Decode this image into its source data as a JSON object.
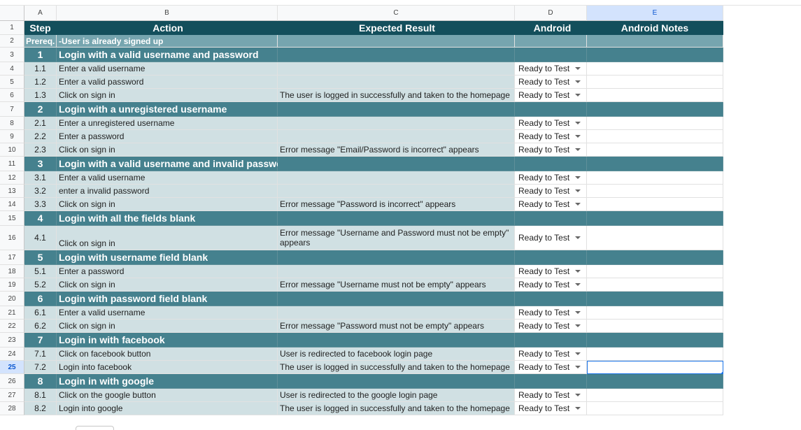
{
  "columns": [
    "A",
    "B",
    "C",
    "D",
    "E"
  ],
  "header_row": {
    "rownum": "1",
    "step": "Step",
    "action": "Action",
    "expected": "Expected Result",
    "android": "Android",
    "notes": "Android Notes"
  },
  "prereq": {
    "rownum": "2",
    "label": "Prereq.",
    "text": "-User is already signed up"
  },
  "groups": [
    {
      "rownum": "3",
      "num": "1",
      "title": "Login with a valid username and password",
      "steps": [
        {
          "rownum": "4",
          "num": "1.1",
          "action": "Enter a valid username",
          "expected": "",
          "status": "Ready to Test"
        },
        {
          "rownum": "5",
          "num": "1.2",
          "action": "Enter a valid password",
          "expected": "",
          "status": "Ready to Test"
        },
        {
          "rownum": "6",
          "num": "1.3",
          "action": "Click on sign in",
          "expected": "The user is logged in successfully and taken to the homepage",
          "status": "Ready to Test"
        }
      ]
    },
    {
      "rownum": "7",
      "num": "2",
      "title": "Login with a unregistered username",
      "steps": [
        {
          "rownum": "8",
          "num": "2.1",
          "action": "Enter a unregistered username",
          "expected": "",
          "status": "Ready to Test"
        },
        {
          "rownum": "9",
          "num": "2.2",
          "action": "Enter a password",
          "expected": "",
          "status": "Ready to Test"
        },
        {
          "rownum": "10",
          "num": "2.3",
          "action": "Click on sign in",
          "expected": "Error message \"Email/Password is incorrect\" appears",
          "status": "Ready to Test"
        }
      ]
    },
    {
      "rownum": "11",
      "num": "3",
      "title": "Login with a valid username and invalid password",
      "steps": [
        {
          "rownum": "12",
          "num": "3.1",
          "action": "Enter a valid username",
          "expected": "",
          "status": "Ready to Test"
        },
        {
          "rownum": "13",
          "num": "3.2",
          "action": "enter a invalid password",
          "expected": "",
          "status": "Ready to Test"
        },
        {
          "rownum": "14",
          "num": "3.3",
          "action": "Click on sign in",
          "expected": "Error message \"Password is incorrect\" appears",
          "status": "Ready to Test"
        }
      ]
    },
    {
      "rownum": "15",
      "num": "4",
      "title": "Login with all the fields blank",
      "steps": [
        {
          "rownum": "16",
          "num": "4.1",
          "action": "Click on sign in",
          "expected": "Error message \"Username and Password must not be empty\" appears",
          "status": "Ready to Test",
          "tall": true
        }
      ]
    },
    {
      "rownum": "17",
      "num": "5",
      "title": "Login with username field blank",
      "steps": [
        {
          "rownum": "18",
          "num": "5.1",
          "action": "Enter a password",
          "expected": "",
          "status": "Ready to Test"
        },
        {
          "rownum": "19",
          "num": "5.2",
          "action": "Click on sign in",
          "expected": "Error message \"Username must not be empty\" appears",
          "status": "Ready to Test"
        }
      ]
    },
    {
      "rownum": "20",
      "num": "6",
      "title": "Login with password field blank",
      "steps": [
        {
          "rownum": "21",
          "num": "6.1",
          "action": "Enter a valid username",
          "expected": "",
          "status": "Ready to Test"
        },
        {
          "rownum": "22",
          "num": "6.2",
          "action": "Click on sign in",
          "expected": "Error message \"Password must not be empty\" appears",
          "status": "Ready to Test"
        }
      ]
    },
    {
      "rownum": "23",
      "num": "7",
      "title": "Login in with facebook",
      "steps": [
        {
          "rownum": "24",
          "num": "7.1",
          "action": "Click on facebook button",
          "expected": "User is redirected to facebook login page",
          "status": "Ready to Test"
        },
        {
          "rownum": "25",
          "num": "7.2",
          "action": "Login into facebook",
          "expected": "The user is logged in successfully and taken to the homepage",
          "status": "Ready to Test",
          "selected": true
        }
      ]
    },
    {
      "rownum": "26",
      "num": "8",
      "title": "Login in with google",
      "steps": [
        {
          "rownum": "27",
          "num": "8.1",
          "action": "Click on the google button",
          "expected": "User is redirected to the google login page",
          "status": "Ready to Test"
        },
        {
          "rownum": "28",
          "num": "8.2",
          "action": "Login into google",
          "expected": "The user is logged in successfully and taken to the homepage",
          "status": "Ready to Test"
        }
      ]
    }
  ],
  "colors": {
    "title_bg": "#134f5c",
    "group_bg": "#45818e",
    "prereq_bg": "#76a5af",
    "step_bg": "#d0e0e3",
    "selection": "#1a73e8"
  },
  "icons": {
    "dropdown": "chevron-down-icon"
  }
}
